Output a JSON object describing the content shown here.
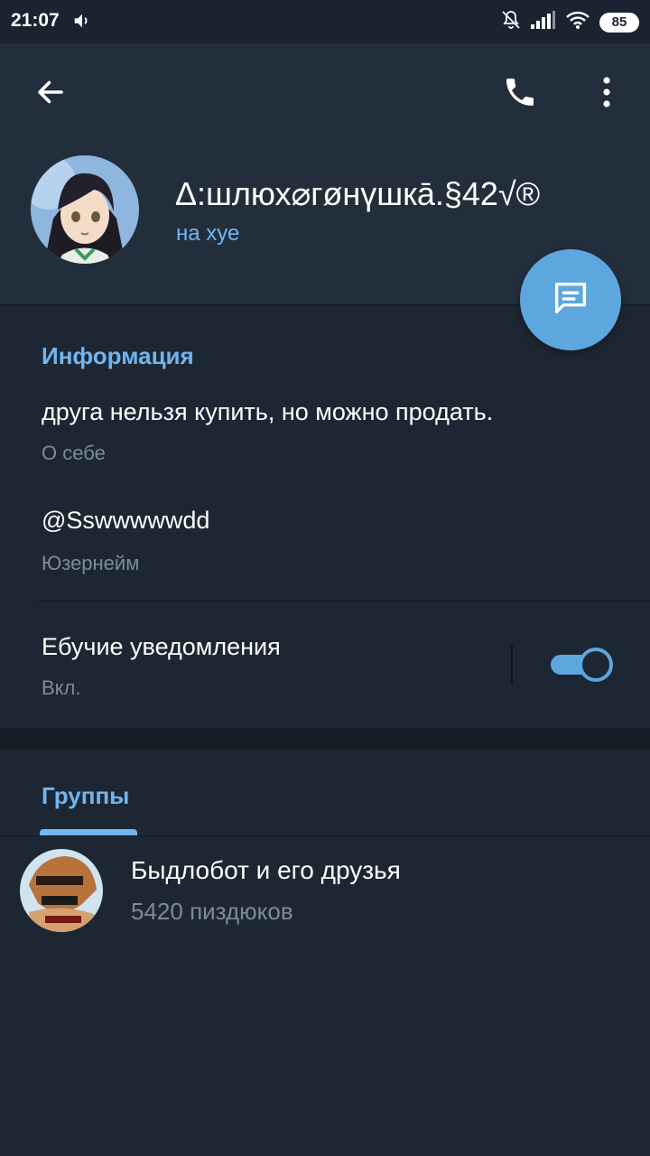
{
  "status_bar": {
    "time": "21:07",
    "battery": "85"
  },
  "toolbar": {
    "back_icon": "arrow-left-icon",
    "call_icon": "phone-icon",
    "menu_icon": "more-vertical-icon"
  },
  "profile": {
    "name": "Δ:шлюх⌀гøнүшкā.§42√®",
    "status": "на хуе"
  },
  "fab": {
    "icon": "message-icon"
  },
  "info": {
    "title": "Информация",
    "bio": "друга нельзя купить, но можно продать.",
    "bio_label": "О себе",
    "username": "@Sswwwwwdd",
    "username_label": "Юзернейм",
    "notifications": "Ебучие уведомления",
    "notifications_state": "Вкл."
  },
  "groups": {
    "title": "Группы",
    "items": [
      {
        "name": "Быдлобот и его друзья",
        "count": "5420 пиздюков"
      }
    ]
  },
  "colors": {
    "accent": "#71b5ee",
    "fab": "#5ea6de",
    "background": "#1d2733",
    "header": "#232e3c",
    "secondary_text": "#7c8b9b"
  }
}
